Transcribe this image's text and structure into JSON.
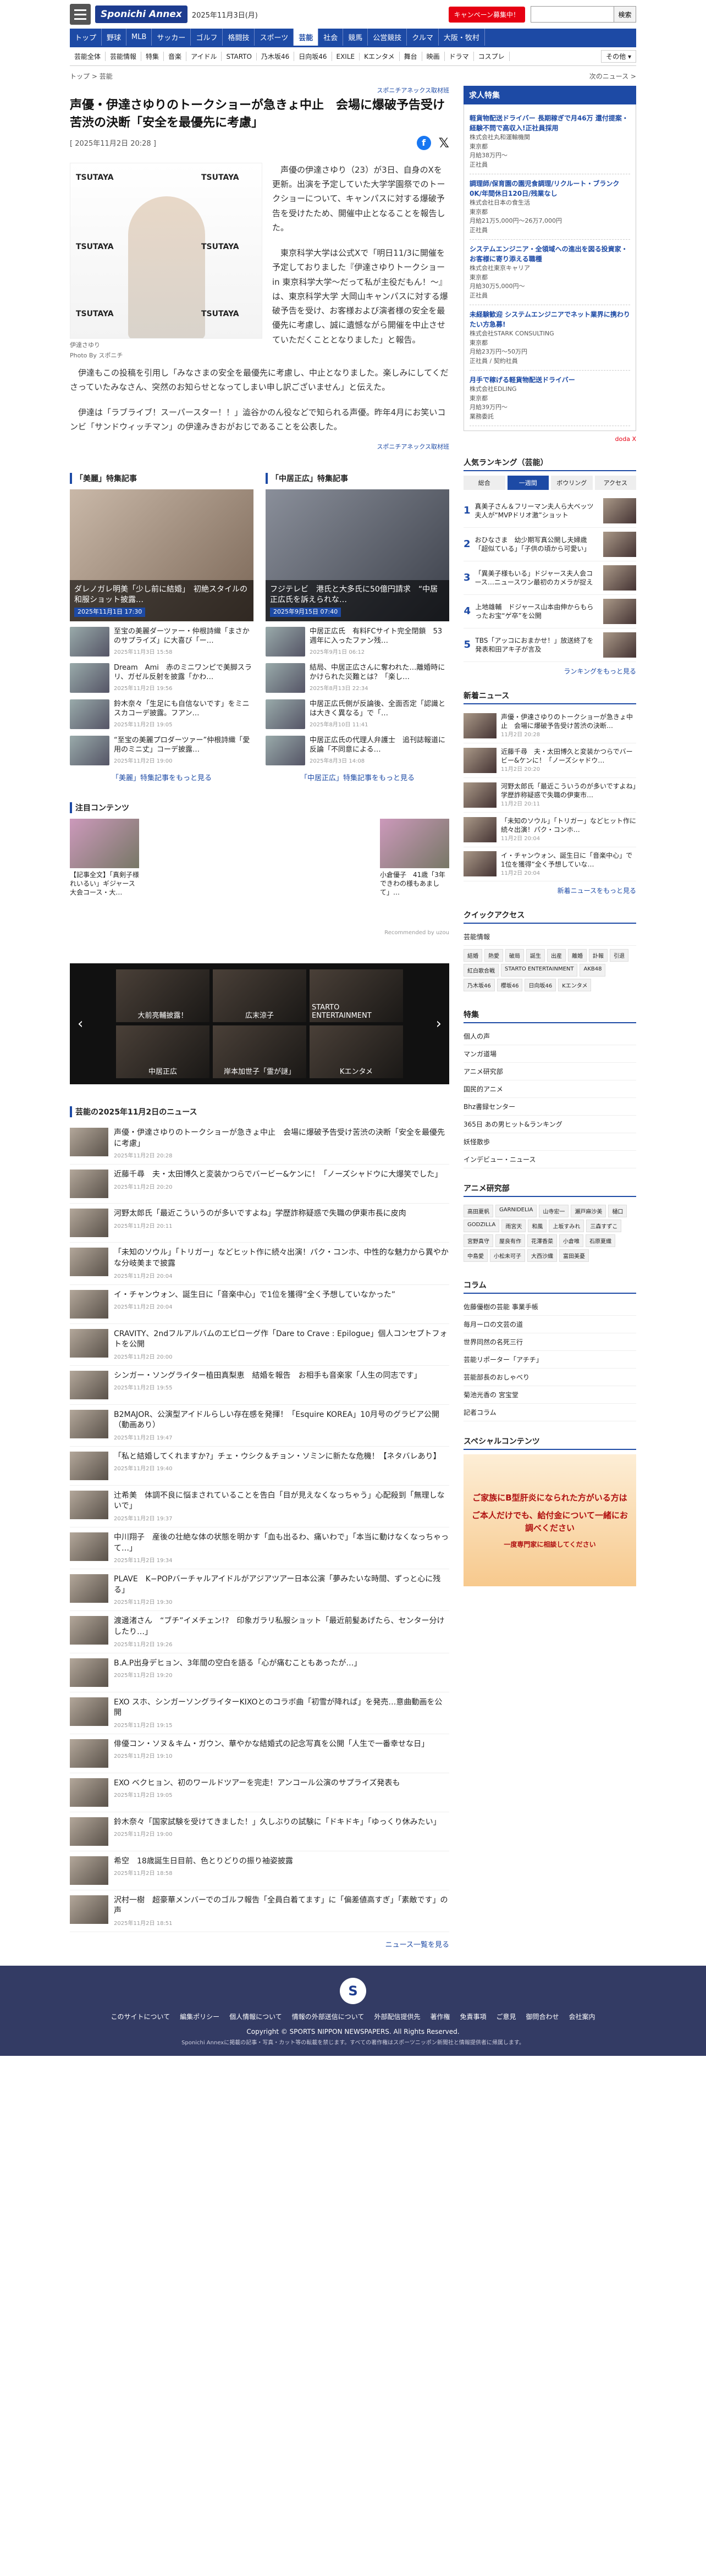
{
  "header": {
    "logo": "Sponichi Annex",
    "date": "2025年11月3日(月)",
    "campaign": "キャンペーン募集中！",
    "search_button": "検索",
    "search_placeholder": ""
  },
  "gnav": [
    "トップ",
    "野球",
    "MLB",
    "サッカー",
    "ゴルフ",
    "格闘技",
    "スポーツ",
    "芸能",
    "社会",
    "競馬",
    "公営競技",
    "クルマ",
    "大阪・牧村"
  ],
  "gnav_active": "芸能",
  "snav": [
    "芸能全体",
    "芸能情報",
    "特集",
    "音楽",
    "アイドル",
    "STARTO",
    "乃木坂46",
    "日向坂46",
    "EXILE",
    "Kエンタメ",
    "舞台",
    "映画",
    "ドラマ",
    "コスプレ"
  ],
  "snav_more": "その他 ▾",
  "crumb": {
    "home": "トップ",
    "sep": ">",
    "cat": "芸能",
    "next": "次のニュース >"
  },
  "article": {
    "sponsor": "スポニチアネックス取材班",
    "title": "声優・伊達さゆりのトークショーが急きょ中止　会場に爆破予告受け苦渋の決断「安全を最優先に考慮」",
    "date": "[ 2025年11月2日 20:28 ]",
    "photo_caption": "伊達さゆり",
    "photo_credit": "Photo By スポニチ",
    "tsutaya": "TSUTAYA",
    "p1": "声優の伊達さゆり（23）が3日、自身のXを更新。出演を予定していた大学学園祭でのトークショーについて、キャンパスに対する爆破予告を受けたため、開催中止となることを報告した。",
    "p2": "東京科学大学は公式Xで「明日11/3に開催を予定しておりました『伊達さゆりトークショー in 東京科学大学〜だって私が主役だもん！〜』は、東京科学大学 大岡山キャンパスに対する爆破予告を受け、お客様および演者様の安全を最優先に考慮し、誠に遺憾ながら開催を中止させていただくこととなりました」と報告。",
    "p3": "伊達もこの投稿を引用し「みなさまの安全を最優先に考慮し、中止となりました。楽しみにしてくださっていたみなさん、突然のお知らせとなってしまい申し訳ございません」と伝えた。",
    "p4": "伊達は「ラブライブ！スーパースター！！」澁谷かのん役などで知られる声優。昨年4月にお笑いコンビ「サンドウィッチマン」の伊達みきおがおじであることを公表した。",
    "footer": "スポニチアネックス取材班"
  },
  "features": [
    {
      "title": "「美麗」特集記事",
      "top": "ダレノガレ明美「少し前に結婚」　初絶スタイルの和服ショット披露…",
      "top_date": "2025年11月1日 17:30",
      "items": [
        {
          "t": "至宝の美麗ダーツァー・仲根詩織「まさかのサプライズ」に大喜び「ー…",
          "d": "2025年11月3日 15:58"
        },
        {
          "t": "Dream　Ami　赤のミニワンピで美脚スラリ、ガゼル反射を披露「かわ…",
          "d": "2025年11月2日 19:56"
        },
        {
          "t": "鈴木奈々「生足にも自信ないです」をミニスカコーデ披露。フアン…",
          "d": "2025年11月2日 19:05"
        },
        {
          "t": "“至宝の美麗プロダーツァー”仲根詩織「愛用のミニ丈」コーデ披露…",
          "d": "2025年11月2日 19:00"
        }
      ],
      "more": "「美麗」特集記事をもっと見る"
    },
    {
      "title": "「中居正広」特集記事",
      "top": "フジテレビ　港氏と大多氏に50億円請求　“中居正広氏を訴えられな…",
      "top_date": "2025年9月15日 07:40",
      "items": [
        {
          "t": "中居正広氏　有料FCサイト完全閉鎖　53週年に入ったファン残…",
          "d": "2025年9月1日 06:12"
        },
        {
          "t": "結局、中居正広さんに奪われた…離婚時にかけられた災難とは？「楽し…",
          "d": "2025年8月13日 22:34"
        },
        {
          "t": "中居正広氏側が反論後、全面否定「認識とは大きく異なる」で「…",
          "d": "2025年8月10日 11:41"
        },
        {
          "t": "中居正広氏の代理人弁護士　追刊誌報道に反論「不同意による…",
          "d": "2025年8月3日 14:08"
        }
      ],
      "more": "「中居正広」特集記事をもっと見る"
    }
  ],
  "notice": {
    "title": "注目コンテンツ",
    "items": [
      {
        "t": "【記事全文】「真剣子様れいるい」ギジャース大会コース・大…"
      },
      {
        "t": "小倉優子　41歳「3年できわの様もあまして」…"
      }
    ],
    "rec": "Recommended by uzou"
  },
  "carousel": [
    "大前亮輔披露！",
    "広末涼子",
    "STARTO ENTERTAINMENT",
    "中居正広",
    "岸本加世子「霊が謎」",
    "Kエンタメ"
  ],
  "newslist": {
    "title": "芸能の2025年11月2日のニュース",
    "items": [
      {
        "t": "声優・伊達さゆりのトークショーが急きょ中止　会場に爆破予告受け苦渋の決断「安全を最優先に考慮」",
        "d": "2025年11月2日 20:28"
      },
      {
        "t": "近藤千尋　夫・太田博久と変装かつらでバービー&ケンに！「ノーズシャドウに大爆笑でした」",
        "d": "2025年11月2日 20:20"
      },
      {
        "t": "河野太郎氏「最近こういうのが多いですよね」学歴詐称疑惑で失職の伊東市長に皮肉",
        "d": "2025年11月2日 20:11"
      },
      {
        "t": "「未知のソウル」「トリガー」などヒット作に続々出演！パク・コンホ、中性的な魅力から異やかな分岐美まで披露",
        "d": "2025年11月2日 20:04"
      },
      {
        "t": "イ・チャンウォン、誕生日に「音楽中心」で1位を獲得“全く予想していなかった”",
        "d": "2025年11月2日 20:04"
      },
      {
        "t": "CRAVITY、2ndフルアルバムのエピローグ作「Dare to Crave : Epilogue」個人コンセプトフォトを公開",
        "d": "2025年11月2日 20:00"
      },
      {
        "t": "シンガー・ソングライター植田真梨恵　結婚を報告　お相手も音楽家「人生の同志です」",
        "d": "2025年11月2日 19:55"
      },
      {
        "t": "B2MAJOR、公演型アイドルらしい存在感を発揮！「Esquire KOREA」10月号のグラビア公開（動画あり）",
        "d": "2025年11月2日 19:47"
      },
      {
        "t": "「私と結婚してくれますか?」チェ・ウシク＆チョン・ソミンに新たな危機！【ネタバレあり】",
        "d": "2025年11月2日 19:40"
      },
      {
        "t": "辻希美　体調不良に悩まされていることを告白「目が見えなくなっちゃう」心配殺到「無理しないで」",
        "d": "2025年11月2日 19:37"
      },
      {
        "t": "中川翔子　産後の壮絶な体の状態を明かす「血も出るわ、痛いわで」「本当に動けなくなっちゃって…」",
        "d": "2025年11月2日 19:34"
      },
      {
        "t": "PLAVE　K−POPバーチャルアイドルがアジアツアー日本公演「夢みたいな時間、ずっと心に残る」",
        "d": "2025年11月2日 19:30"
      },
      {
        "t": "渡邊渚さん　“ブチ”イメチェン!?　印象ガラリ私服ショット「最近前髪あげたら、センター分けしたり…」",
        "d": "2025年11月2日 19:26"
      },
      {
        "t": "B.A.P出身デヒョン、3年間の空白を語る「心が痛むこともあったが…」",
        "d": "2025年11月2日 19:20"
      },
      {
        "t": "EXO スホ、シンガーソングライターKIXOとのコラボ曲「初雪が降れば」を発売…意曲動画を公開",
        "d": "2025年11月2日 19:15"
      },
      {
        "t": "俳優コン・ソヌ＆キム・ガウン、華やかな結婚式の記念写真を公開「人生で一番幸せな日」",
        "d": "2025年11月2日 19:10"
      },
      {
        "t": "EXO ベクヒョン、初のワールドツアーを完走！アンコール公演のサプライズ発表も",
        "d": "2025年11月2日 19:05"
      },
      {
        "t": "鈴木奈々「国家試験を受けてきました！」久しぶりの試験に「ドキドキ」「ゆっくり休みたい」",
        "d": "2025年11月2日 19:00"
      },
      {
        "t": "希空　18歳誕生日目前、色とりどりの振り袖姿披露",
        "d": "2025年11月2日 18:58"
      },
      {
        "t": "沢村一樹　超豪華メンバーでのゴルフ報告「全員白着てます」に「偏差値高すぎ」「素敵です」の声",
        "d": "2025年11月2日 18:51"
      }
    ],
    "more": "ニュース一覧を見る"
  },
  "side": {
    "jobs_title": "求人特集",
    "jobs": [
      {
        "t": "軽貨物配送ドライバー 長期稼ぎで月46万 還付提案・経験不問で高収入!正社員採用",
        "c": "株式会社丸和運輸機関",
        "p": "東京都",
        "s": "月給38万円〜",
        "e": "正社員"
      },
      {
        "t": "調理師/保育園の園児食調理/リクルート・ブランク0K/年間休日120日/残業なし",
        "c": "株式会社日本の食生活",
        "p": "東京都",
        "s": "月給21万5,000円〜26万7,000円",
        "e": "正社員"
      },
      {
        "t": "システムエンジニア・全領域への進出を図る投資家・お客様に寄り添える職種",
        "c": "株式会社東京キャリア",
        "p": "東京都",
        "s": "月給30万5,000円〜",
        "e": "正社員"
      },
      {
        "t": "未経験歓迎 システムエンジニアでネット業界に携わりたい方急募!",
        "c": "株式会社STARK CONSULTING",
        "p": "東京都",
        "s": "月給23万円〜50万円",
        "e": "正社員 / 契約社員"
      },
      {
        "t": "月手で稼げる軽貨物配送ドライバー",
        "c": "株式会社EDLING",
        "p": "東京都",
        "s": "月給39万円〜",
        "e": "業務委託"
      }
    ],
    "doda": "doda X",
    "rank_title": "人気ランキング（芸能）",
    "rank_tabs": [
      "総合",
      "一週間",
      "ボウリング",
      "アクセス"
    ],
    "ranks": [
      {
        "t": "真美子さん＆フリーマン夫人ら大ベッツ夫人が“MVPドリオ激”ショット",
        "n": "1"
      },
      {
        "t": "おひなさま　幼少期写真公開し夫婦歳「超似ている」「子供の頃から可愛い」",
        "n": "2"
      },
      {
        "t": "「異美子様もいる」ドジャース夫人会コース…ニュースワン最初のカメラが捉え",
        "n": "3"
      },
      {
        "t": "上地雄輔　ドジャース山本由伸からもらったお宝“ゲ卒”を公開",
        "n": "4"
      },
      {
        "t": "TBS「アッコにおまかせ！」放送終了を発表和田アキ子が言及",
        "n": "5"
      }
    ],
    "rank_more": "ランキングをもっと見る",
    "newest_title": "新着ニュース",
    "newest": [
      {
        "t": "声優・伊達さゆりのトークショーが急きょ中止　会場に爆破予告受け苦渋の決断…",
        "d": "11月2日 20:28"
      },
      {
        "t": "近藤千尋　夫・太田博久と変装かつらでバービー&ケンに！「ノーズシャドウ…",
        "d": "11月2日 20:20"
      },
      {
        "t": "河野太郎氏「最近こういうのが多いですよね」学歴詐称疑惑で失職の伊東市…",
        "d": "11月2日 20:11"
      },
      {
        "t": "「未知のソウル」「トリガー」などヒット作に続々出演！パク・コンホ…",
        "d": "11月2日 20:04"
      },
      {
        "t": "イ・チャンウォン、誕生日に「音楽中心」で1位を獲得“全く予想していな…",
        "d": "11月2日 20:04"
      }
    ],
    "newest_more": "新着ニュースをもっと見る",
    "qa_title": "クイックアクセス",
    "qa_sub": "芸能情報",
    "qa_tags": [
      "結婚",
      "熱愛",
      "破局",
      "誕生",
      "出産",
      "離婚",
      "訃報",
      "引退",
      "紅白歌合戦",
      "STARTO ENTERTAINMENT",
      "AKB48",
      "乃木坂46",
      "櫻坂46",
      "日向坂46",
      "Kエンタメ"
    ],
    "special_title": "特集",
    "specials": [
      "個人の声",
      "マンガ道場",
      "アニメ研究部",
      "国民的アニメ",
      "Bhz書録センター",
      "365日 あの男ヒット&ランキング",
      "妖怪散歩",
      "インデビュー・ニュース"
    ],
    "anime_title": "アニメ研究部",
    "anime_tags": [
      "高田夏帆",
      "GARNIDELIA",
      "山寺宏一",
      "瀬戸麻沙美",
      "樋口",
      "GODZILLA",
      "雨宮天",
      "和風",
      "上坂すみれ",
      "三森すずこ",
      "宮野真守",
      "屋良有作",
      "花澤香菜",
      "小倉唯",
      "石原夏織",
      "中島愛",
      "小松未可子",
      "大西沙織",
      "富田美憂"
    ],
    "column_title": "コラム",
    "columns": [
      "佐藤優樹の芸能 事業手帳",
      "毎月ーロの文芸の道",
      "世界同然の名死三行",
      "芸能リポーター「アチチ」",
      "芸能部長のおしゃべり",
      "菊池光香の 宮宝堂",
      "記者コラム"
    ],
    "sp_title": "スペシャルコンテンツ",
    "ad_lines": [
      "ご家族にB型肝炎になられた方がいる方は",
      "ご本人だけでも、給付金について一緒にお調べください",
      "一度専門家に相談してください"
    ]
  },
  "footer": {
    "logo": "S",
    "links": [
      "このサイトについて",
      "編集ポリシー",
      "個人情報について",
      "情報の外部送信について",
      "外部配信提供先",
      "著作権",
      "免責事項",
      "ご意見",
      "御問合わせ",
      "会社案内"
    ],
    "copy": "Copyright © SPORTS NIPPON NEWSPAPERS. All Rights Reserved.",
    "note": "Sponichi Annexに掲載の記事・写真・カット等の転載を禁じます。すべての著作権はスポーツニッポン新聞社と情報提供者に帰属します。"
  }
}
